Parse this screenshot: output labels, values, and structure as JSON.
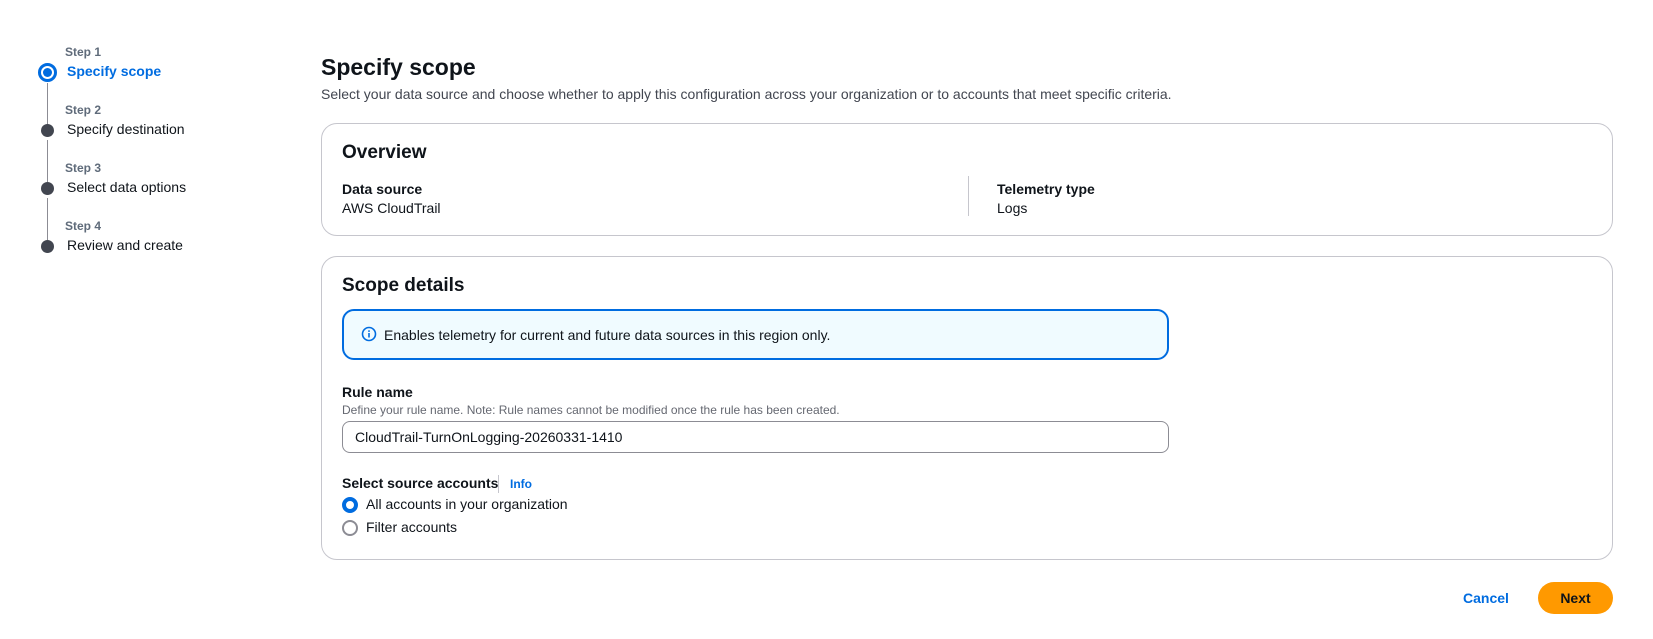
{
  "steps": [
    {
      "caption": "Step 1",
      "title": "Specify scope",
      "active": true
    },
    {
      "caption": "Step 2",
      "title": "Specify destination",
      "active": false
    },
    {
      "caption": "Step 3",
      "title": "Select data options",
      "active": false
    },
    {
      "caption": "Step 4",
      "title": "Review and create",
      "active": false
    }
  ],
  "page": {
    "title": "Specify scope",
    "description": "Select your data source and choose whether to apply this configuration across your organization or to accounts that meet specific criteria."
  },
  "overview": {
    "title": "Overview",
    "data_source_label": "Data source",
    "data_source_value": "AWS CloudTrail",
    "telemetry_type_label": "Telemetry type",
    "telemetry_type_value": "Logs"
  },
  "scope": {
    "title": "Scope details",
    "alert_text": "Enables telemetry for current and future data sources in this region only.",
    "alert_icon": "info-circle-icon",
    "rule_name_label": "Rule name",
    "rule_name_hint": "Define your rule name. Note: Rule names cannot be modified once the rule has been created.",
    "rule_name_value": "CloudTrail-TurnOnLogging-20260331-1410",
    "source_accounts_label": "Select source accounts",
    "info_link": "Info",
    "options": [
      {
        "label": "All accounts in your organization",
        "checked": true
      },
      {
        "label": "Filter accounts",
        "checked": false
      }
    ]
  },
  "actions": {
    "cancel": "Cancel",
    "next": "Next"
  },
  "colors": {
    "accent": "#006ce0",
    "primary_button": "#ff9900",
    "alert_bg": "#f0fbff"
  }
}
